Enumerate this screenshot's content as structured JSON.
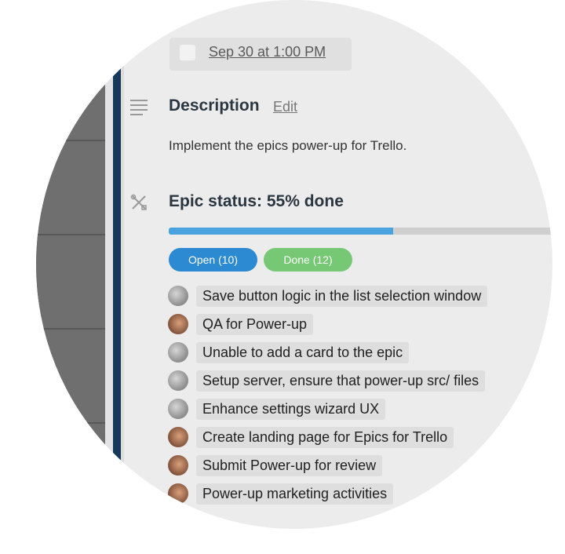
{
  "due_date": {
    "text": "Sep 30 at 1:00 PM"
  },
  "description": {
    "title": "Description",
    "edit_label": "Edit",
    "text": "Implement the epics power-up for Trello."
  },
  "epic": {
    "title": "Epic status: 55% done",
    "progress_fraction": 0.55,
    "open_label": "Open (10)",
    "done_label": "Done (12)",
    "colors": {
      "progress": "#4aa3df",
      "open": "#2b8ad1",
      "done": "#76c874"
    },
    "items": [
      {
        "label": "Save button logic in the list selection window",
        "avatar": "grey"
      },
      {
        "label": "QA for Power-up",
        "avatar": "brown"
      },
      {
        "label": "Unable to add a card to the epic",
        "avatar": "grey"
      },
      {
        "label": "Setup server, ensure that power-up src/ files",
        "avatar": "grey"
      },
      {
        "label": "Enhance settings wizard UX",
        "avatar": "grey"
      },
      {
        "label": "Create landing page for Epics for Trello",
        "avatar": "brown"
      },
      {
        "label": "Submit Power-up for review",
        "avatar": "brown"
      },
      {
        "label": "Power-up marketing activities",
        "avatar": "brown"
      }
    ]
  },
  "icons": {
    "description": "description-lines-icon",
    "epic": "epic-tools-icon"
  }
}
